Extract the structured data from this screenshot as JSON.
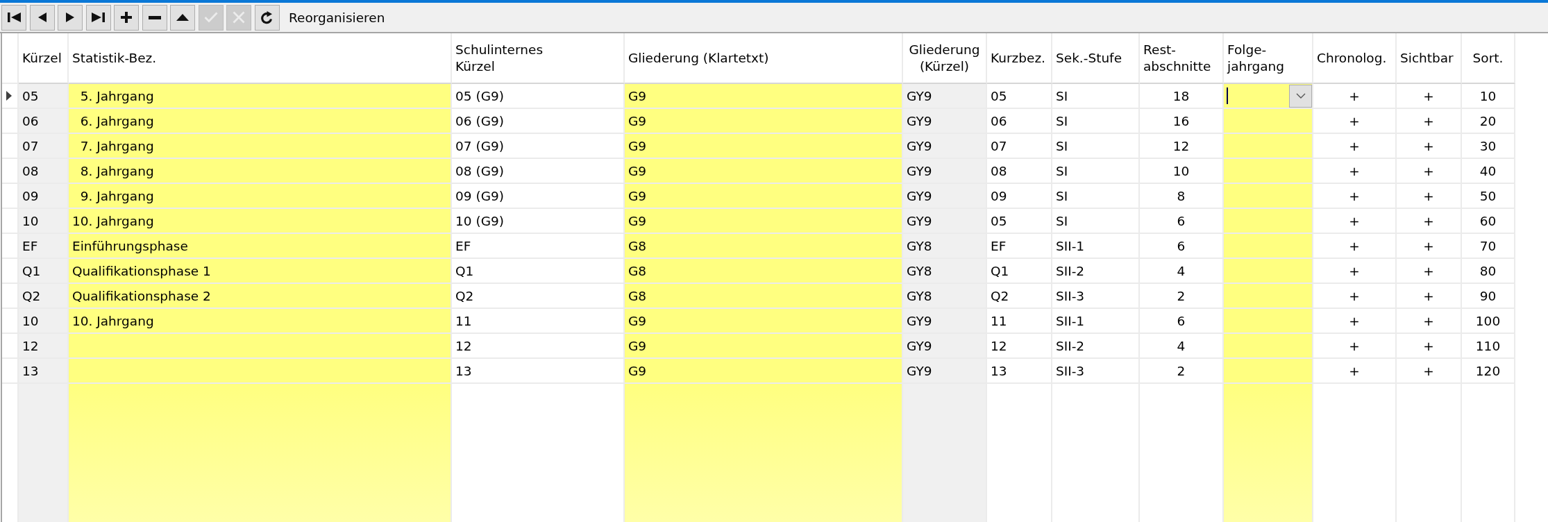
{
  "toolbar": {
    "buttons": [
      {
        "kind": "first",
        "disabled": false
      },
      {
        "kind": "prev",
        "disabled": false
      },
      {
        "kind": "next",
        "disabled": false
      },
      {
        "kind": "last",
        "disabled": false
      },
      {
        "kind": "add",
        "disabled": false
      },
      {
        "kind": "remove",
        "disabled": false
      },
      {
        "kind": "up",
        "disabled": false
      },
      {
        "kind": "confirm",
        "disabled": true
      },
      {
        "kind": "cancel",
        "disabled": true
      },
      {
        "kind": "refresh",
        "disabled": false
      }
    ],
    "reorganize_button": {
      "label": "Reorganisieren"
    }
  },
  "table": {
    "columns": [
      {
        "label": "Kürzel",
        "kind": "readonly"
      },
      {
        "label": "Statistik-Bez.",
        "kind": "lookup"
      },
      {
        "label": "Schulinternes\nKürzel",
        "kind": "text"
      },
      {
        "label": "Gliederung (Klartetxt)",
        "kind": "lookup"
      },
      {
        "label": "Gliederung\n(Kürzel)",
        "kind": "readonly"
      },
      {
        "label": "Kurzbez.",
        "kind": "text"
      },
      {
        "label": "Sek.-Stufe",
        "kind": "text"
      },
      {
        "label": "Rest-\nabschnitte",
        "kind": "text"
      },
      {
        "label": "Folge-\njahrgang",
        "kind": "lookup"
      },
      {
        "label": "Chronolog.",
        "kind": "text"
      },
      {
        "label": "Sichtbar",
        "kind": "text"
      },
      {
        "label": "Sort.",
        "kind": "text"
      }
    ],
    "rows": [
      {
        "selected": true,
        "cells": [
          "05",
          "  5. Jahrgang",
          "05 (G9)",
          "G9",
          "GY9",
          "05",
          "SI",
          "18",
          null,
          "+",
          "+",
          "10"
        ]
      },
      {
        "selected": false,
        "cells": [
          "06",
          "  6. Jahrgang",
          "06 (G9)",
          "G9",
          "GY9",
          "06",
          "SI",
          "16",
          null,
          "+",
          "+",
          "20"
        ]
      },
      {
        "selected": false,
        "cells": [
          "07",
          "  7. Jahrgang",
          "07 (G9)",
          "G9",
          "GY9",
          "07",
          "SI",
          "12",
          null,
          "+",
          "+",
          "30"
        ]
      },
      {
        "selected": false,
        "cells": [
          "08",
          "  8. Jahrgang",
          "08 (G9)",
          "G9",
          "GY9",
          "08",
          "SI",
          "10",
          null,
          "+",
          "+",
          "40"
        ]
      },
      {
        "selected": false,
        "cells": [
          "09",
          "  9. Jahrgang",
          "09 (G9)",
          "G9",
          "GY9",
          "09",
          "SI",
          "8",
          null,
          "+",
          "+",
          "50"
        ]
      },
      {
        "selected": false,
        "cells": [
          "10",
          "10. Jahrgang",
          "10 (G9)",
          "G9",
          "GY9",
          "05",
          "SI",
          "6",
          null,
          "+",
          "+",
          "60"
        ]
      },
      {
        "selected": false,
        "cells": [
          "EF",
          "Einführungsphase",
          "EF",
          "G8",
          "GY8",
          "EF",
          "SII-1",
          "6",
          null,
          "+",
          "+",
          "70"
        ]
      },
      {
        "selected": false,
        "cells": [
          "Q1",
          "Qualifikationsphase 1",
          "Q1",
          "G8",
          "GY8",
          "Q1",
          "SII-2",
          "4",
          null,
          "+",
          "+",
          "80"
        ]
      },
      {
        "selected": false,
        "cells": [
          "Q2",
          "Qualifikationsphase 2",
          "Q2",
          "G8",
          "GY8",
          "Q2",
          "SII-3",
          "2",
          null,
          "+",
          "+",
          "90"
        ]
      },
      {
        "selected": false,
        "cells": [
          "10",
          "10. Jahrgang",
          "11",
          "G9",
          "GY9",
          "11",
          "SII-1",
          "6",
          null,
          "+",
          "+",
          "100"
        ]
      },
      {
        "selected": false,
        "cells": [
          "12",
          null,
          "12",
          "G9",
          "GY9",
          "12",
          "SII-2",
          "4",
          null,
          "+",
          "+",
          "110"
        ]
      },
      {
        "selected": false,
        "cells": [
          "13",
          null,
          "13",
          "G9",
          "GY9",
          "13",
          "SII-3",
          "2",
          null,
          "+",
          "+",
          "120"
        ]
      }
    ]
  }
}
